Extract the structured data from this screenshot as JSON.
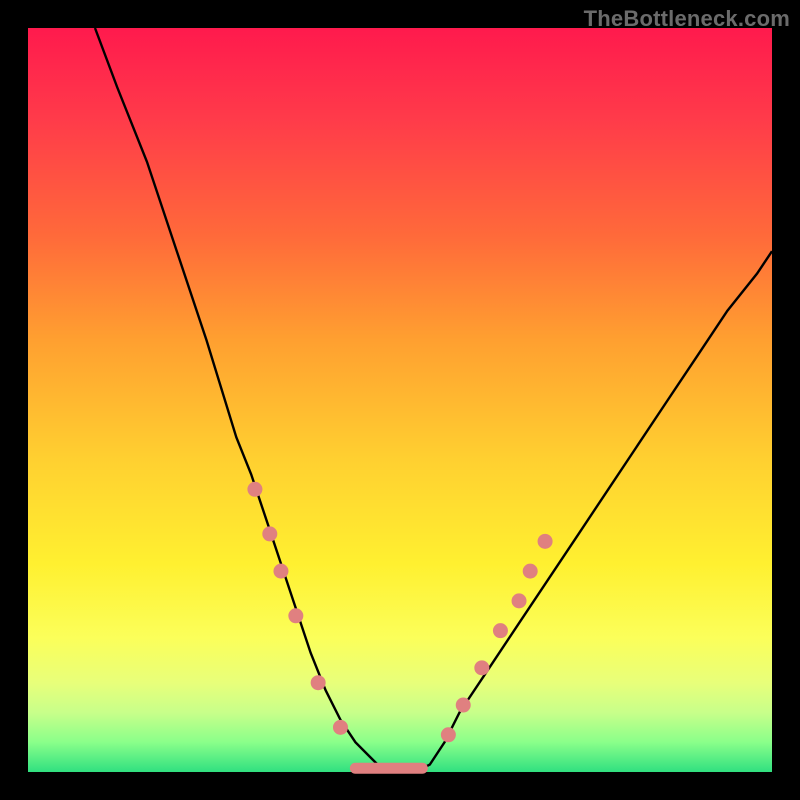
{
  "watermark": "TheBottleneck.com",
  "chart_data": {
    "type": "line",
    "title": "",
    "xlabel": "",
    "ylabel": "",
    "xlim": [
      0,
      100
    ],
    "ylim": [
      0,
      100
    ],
    "series": [
      {
        "name": "bottleneck-curve",
        "x": [
          9,
          12,
          16,
          20,
          24,
          28,
          30,
          32,
          34,
          36,
          38,
          40,
          42,
          44,
          46,
          48,
          50,
          52,
          54,
          56,
          58,
          62,
          66,
          70,
          74,
          78,
          82,
          86,
          90,
          94,
          98,
          100
        ],
        "y": [
          100,
          92,
          82,
          70,
          58,
          45,
          40,
          34,
          28,
          22,
          16,
          11,
          7,
          4,
          2,
          0,
          0,
          0,
          1,
          4,
          8,
          14,
          20,
          26,
          32,
          38,
          44,
          50,
          56,
          62,
          67,
          70
        ]
      }
    ],
    "markers": {
      "left_branch": [
        {
          "x": 30.5,
          "y": 38
        },
        {
          "x": 32.5,
          "y": 32
        },
        {
          "x": 34.0,
          "y": 27
        },
        {
          "x": 36.0,
          "y": 21
        },
        {
          "x": 39.0,
          "y": 12
        },
        {
          "x": 42.0,
          "y": 6
        }
      ],
      "right_branch": [
        {
          "x": 56.5,
          "y": 5
        },
        {
          "x": 58.5,
          "y": 9
        },
        {
          "x": 61.0,
          "y": 14
        },
        {
          "x": 63.5,
          "y": 19
        },
        {
          "x": 66.0,
          "y": 23
        },
        {
          "x": 67.5,
          "y": 27
        },
        {
          "x": 69.5,
          "y": 31
        }
      ],
      "flat_segment": {
        "x_start": 44,
        "x_end": 53,
        "y": 0.5
      }
    }
  }
}
